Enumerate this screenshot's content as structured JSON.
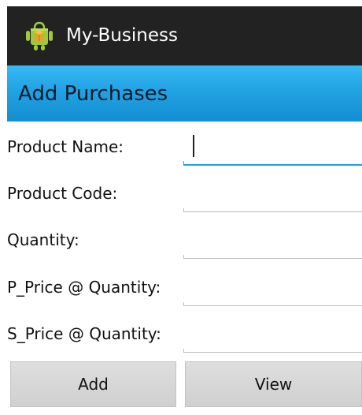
{
  "app": {
    "title": "My-Business",
    "icon": "android-robot-icon",
    "colors": {
      "actionbar_bg": "#222222",
      "titlebar_bg": "#21a2e3",
      "focus_accent": "#1fa3e0"
    }
  },
  "screen": {
    "title": "Add Purchases"
  },
  "form": {
    "fields": [
      {
        "label": "Product Name:",
        "value": "",
        "focused": true
      },
      {
        "label": "Product Code:",
        "value": ""
      },
      {
        "label": "Quantity:",
        "value": ""
      },
      {
        "label": "P_Price @ Quantity:",
        "value": ""
      },
      {
        "label": "S_Price @ Quantity:",
        "value": ""
      }
    ]
  },
  "buttons": {
    "add_label": "Add",
    "view_label": "View"
  }
}
